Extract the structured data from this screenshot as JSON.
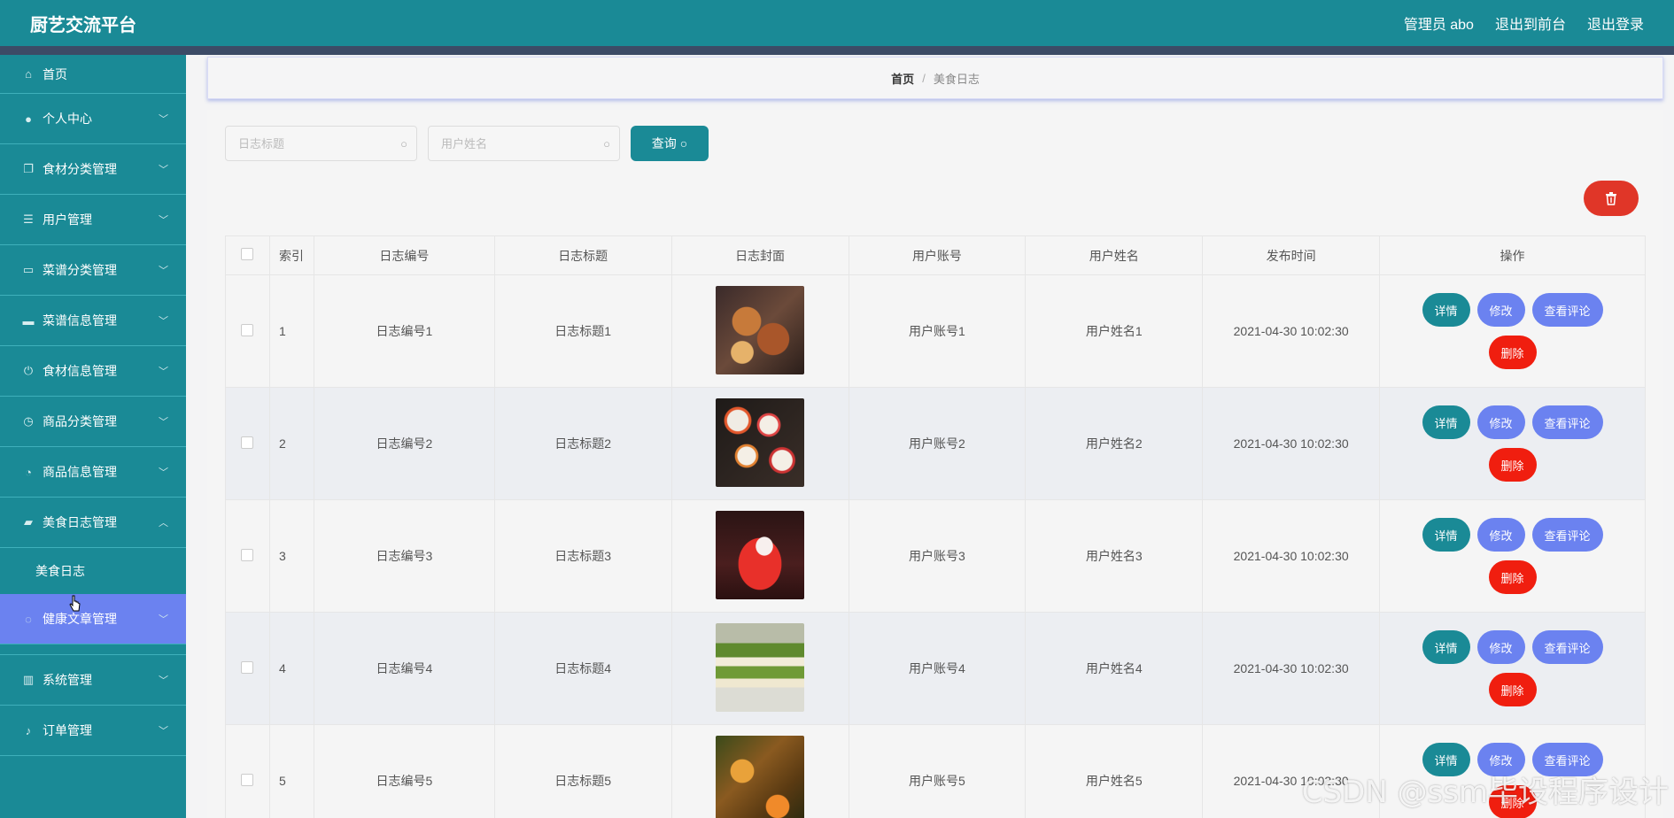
{
  "header": {
    "title": "厨艺交流平台",
    "admin_label": "管理员 abo",
    "to_front_label": "退出到前台",
    "logout_label": "退出登录"
  },
  "sidebar": {
    "items": [
      {
        "label": "首页",
        "icon": "home-icon"
      },
      {
        "label": "个人中心",
        "icon": "user-icon"
      },
      {
        "label": "食材分类管理",
        "icon": "copy-icon"
      },
      {
        "label": "用户管理",
        "icon": "list-icon"
      },
      {
        "label": "菜谱分类管理",
        "icon": "chat-icon"
      },
      {
        "label": "菜谱信息管理",
        "icon": "monitor-icon"
      },
      {
        "label": "食材信息管理",
        "icon": "power-icon"
      },
      {
        "label": "商品分类管理",
        "icon": "clock-icon"
      },
      {
        "label": "商品信息管理",
        "icon": "compass-icon"
      },
      {
        "label": "美食日志管理",
        "icon": "suitcase-icon"
      },
      {
        "label": "健康文章管理",
        "icon": "info-icon"
      },
      {
        "label": "系统管理",
        "icon": "chart-icon"
      },
      {
        "label": "订单管理",
        "icon": "mic-icon"
      }
    ],
    "sub_item": "美食日志",
    "hover_label_visible": "健康",
    "hover_label_rest": "章管理"
  },
  "breadcrumb": {
    "home": "首页",
    "separator": "/",
    "current": "美食日志"
  },
  "search": {
    "title_placeholder": "日志标题",
    "name_placeholder": "用户姓名",
    "query_label": "查询"
  },
  "table": {
    "headers": [
      "索引",
      "日志编号",
      "日志标题",
      "日志封面",
      "用户账号",
      "用户姓名",
      "发布时间",
      "操作"
    ],
    "rows": [
      {
        "index": "1",
        "code": "日志编号1",
        "title": "日志标题1",
        "account": "用户账号1",
        "name": "用户姓名1",
        "time": "2021-04-30 10:02:30"
      },
      {
        "index": "2",
        "code": "日志编号2",
        "title": "日志标题2",
        "account": "用户账号2",
        "name": "用户姓名2",
        "time": "2021-04-30 10:02:30"
      },
      {
        "index": "3",
        "code": "日志编号3",
        "title": "日志标题3",
        "account": "用户账号3",
        "name": "用户姓名3",
        "time": "2021-04-30 10:02:30"
      },
      {
        "index": "4",
        "code": "日志编号4",
        "title": "日志标题4",
        "account": "用户账号4",
        "name": "用户姓名4",
        "time": "2021-04-30 10:02:30"
      },
      {
        "index": "5",
        "code": "日志编号5",
        "title": "日志标题5",
        "account": "用户账号5",
        "name": "用户姓名5",
        "time": "2021-04-30 10:02:30"
      }
    ],
    "actions": {
      "detail": "详情",
      "edit": "修改",
      "comments": "查看评论",
      "delete": "删除"
    }
  },
  "watermark": "CSDN @ssm毕设程序设计",
  "colors": {
    "primary": "#1a8a96",
    "accent": "#6b82f0",
    "danger": "#f01e0f",
    "header_strip": "#3c4b66"
  }
}
